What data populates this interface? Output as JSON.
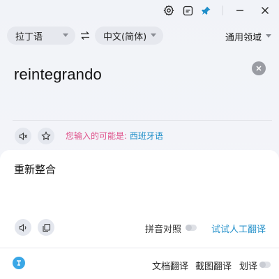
{
  "titlebar": {
    "buttons": [
      {
        "icon": "settings-gear-icon"
      },
      {
        "icon": "screenshot-icon"
      },
      {
        "icon": "pin-icon",
        "color": "#1f8ec9"
      },
      {
        "icon": "minimize-icon"
      },
      {
        "icon": "close-icon"
      }
    ]
  },
  "languages": {
    "source": "拉丁语",
    "target": "中文(简体)",
    "swap_icon": "swap-arrows-icon",
    "domain": "通用领域"
  },
  "source": {
    "text": "reintegrando",
    "detect_prefix": "您输入的可能是: ",
    "detect_language": "西班牙语",
    "speaker_icon": "speaker-muted-icon",
    "favorite_icon": "star-icon"
  },
  "result": {
    "text": "重新整合",
    "speaker_icon": "speaker-icon",
    "copy_icon": "copy-icon",
    "pinyin_label": "拼音对照",
    "pinyin_enabled": false,
    "human_translate": "试试人工翻译"
  },
  "bottom": {
    "logo_icon": "app-logo-icon",
    "doc_translate": "文档翻译",
    "screenshot_translate": "截图翻译",
    "selection_translate": "划译",
    "selection_enabled": false
  },
  "colors": {
    "accent": "#1f8ec9",
    "detect_pink": "#e0518b"
  }
}
